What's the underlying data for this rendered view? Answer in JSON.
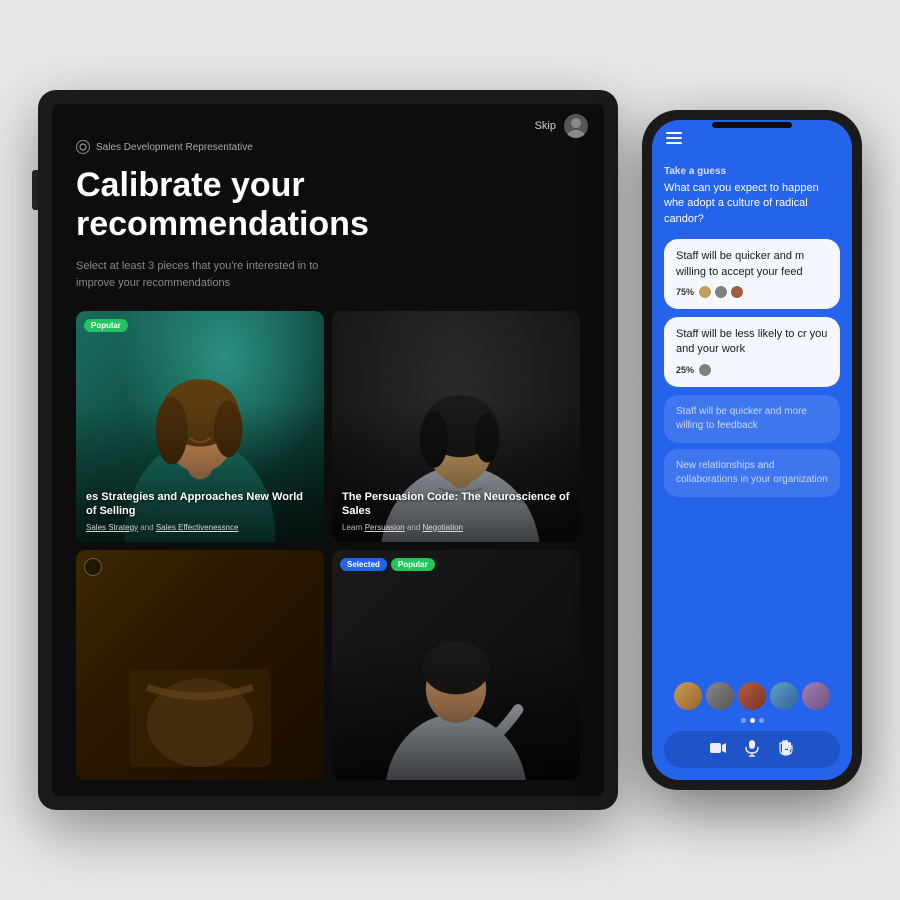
{
  "scene": {
    "background": "#e8e8e8"
  },
  "tablet": {
    "skip_label": "Skip",
    "role_label": "Sales Development Representative",
    "main_title": "Calibrate your recommendations",
    "subtitle": "Select at least 3 pieces that you're interested in to improve your recommendations",
    "cards": [
      {
        "id": "card-1",
        "badge": "Popular",
        "badge_type": "popular",
        "title": "es Strategies and Approaches New World of Selling",
        "tags": "Sales Strategy and Sales Effectivenessnce",
        "has_figure": true
      },
      {
        "id": "card-2",
        "badge": "",
        "title": "The Persuasion Code: The Neuroscience of Sales",
        "tags": "Learn Persuasion and Negotiation",
        "has_figure": true
      },
      {
        "id": "card-3",
        "badge": "",
        "title": "",
        "tags": "",
        "has_figure": false
      },
      {
        "id": "card-4",
        "badge_selected": "Selected",
        "badge_popular": "Popular",
        "title": "",
        "tags": "",
        "has_figure": true
      }
    ]
  },
  "phone": {
    "question_label": "Take a guess",
    "question_text": "What can you expect to happen whe adopt a culture of radical candor?",
    "answers": [
      {
        "id": "answer-1",
        "text": "Staff will be quicker and m willing to accept your feed",
        "percent": "75%",
        "selected": true,
        "has_avatars": true
      },
      {
        "id": "answer-2",
        "text": "Staff will be less likely to cr you and your work",
        "percent": "25%",
        "selected": false,
        "highlighted": true,
        "has_avatars": true
      },
      {
        "id": "answer-3",
        "text": "Staff will be quicker and more willing to feedback",
        "selected": false,
        "gray": true
      },
      {
        "id": "answer-4",
        "text": "New relationships and collaborations in your organization",
        "selected": false,
        "gray": true
      }
    ],
    "toolbar_icons": [
      "video",
      "mic",
      "hand"
    ],
    "dots": [
      false,
      true,
      false
    ]
  }
}
